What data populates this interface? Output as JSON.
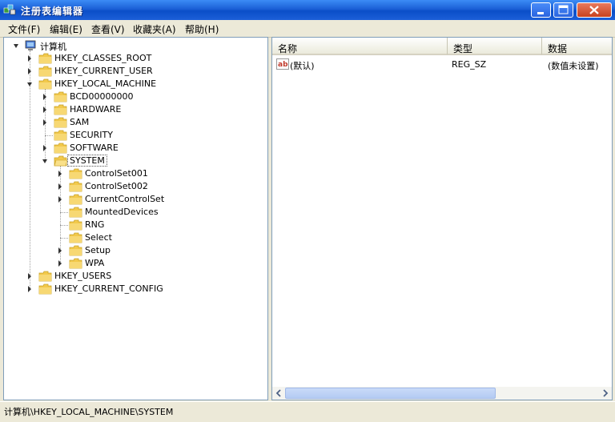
{
  "window": {
    "title": "注册表编辑器"
  },
  "menu": {
    "items": [
      {
        "label": "文件(F)"
      },
      {
        "label": "编辑(E)"
      },
      {
        "label": "查看(V)"
      },
      {
        "label": "收藏夹(A)"
      },
      {
        "label": "帮助(H)"
      }
    ]
  },
  "tree": {
    "root": "计算机",
    "hives": {
      "classes_root": "HKEY_CLASSES_ROOT",
      "current_user": "HKEY_CURRENT_USER",
      "local_machine": "HKEY_LOCAL_MACHINE",
      "users": "HKEY_USERS",
      "current_config": "HKEY_CURRENT_CONFIG"
    },
    "local_machine_children": {
      "bcd": "BCD00000000",
      "hardware": "HARDWARE",
      "sam": "SAM",
      "security": "SECURITY",
      "software": "SOFTWARE",
      "system": "SYSTEM"
    },
    "system_children": {
      "cs001": "ControlSet001",
      "cs002": "ControlSet002",
      "ccs": "CurrentControlSet",
      "mounted": "MountedDevices",
      "rng": "RNG",
      "select": "Select",
      "setup": "Setup",
      "wpa": "WPA"
    },
    "selected": "SYSTEM"
  },
  "list": {
    "columns": {
      "name": "名称",
      "type": "类型",
      "data": "数据"
    },
    "rows": [
      {
        "name": "(默认)",
        "type": "REG_SZ",
        "data": "(数值未设置)"
      }
    ]
  },
  "status": {
    "path": "计算机\\HKEY_LOCAL_MACHINE\\SYSTEM"
  },
  "colors": {
    "titlebar": "#0a4ec8",
    "folder": "#f2c94c",
    "pane_border": "#7f9db9",
    "chrome": "#ece9d8"
  }
}
